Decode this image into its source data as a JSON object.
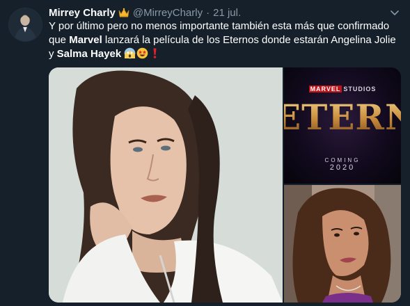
{
  "tweet": {
    "display_name": "Mirrey Charly",
    "name_badge_icon": "crown-emoji",
    "handle": "@MirreyCharly",
    "separator": "·",
    "date": "21 jul.",
    "text_part1": "Y por último pero no menos importante también esta más que confirmado que ",
    "text_bold1": "Marvel",
    "text_part2": " lanzará la película de los Eternos donde estarán Angelina Jolie y ",
    "text_bold2": "Salma Hayek",
    "text_emojis": [
      "scream-emoji",
      "star-struck-emoji",
      "heavy-exclamation-emoji"
    ]
  },
  "media": {
    "poster_studio_prefix": "MARVEL",
    "poster_studio_suffix": "STUDIOS",
    "poster_title": "ETERNALS",
    "poster_coming": "COMING",
    "poster_year": "2020"
  },
  "colors": {
    "background": "#15202b",
    "secondary_text": "#8899a6",
    "primary_text": "#ffffff"
  }
}
